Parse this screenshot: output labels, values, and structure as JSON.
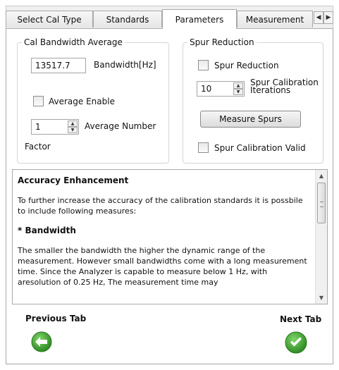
{
  "tabs": [
    {
      "label": "Select Cal Type"
    },
    {
      "label": "Standards"
    },
    {
      "label": "Parameters"
    },
    {
      "label": "Measurement"
    }
  ],
  "cal_bandwidth_average": {
    "group_title": "Cal Bandwidth  Average",
    "bandwidth_value": "13517.7",
    "bandwidth_label": "Bandwidth[Hz]",
    "average_enable_label": "Average Enable",
    "average_enable_checked": false,
    "average_number_value": "1",
    "average_number_label": "Average Number",
    "factor_label": "Factor"
  },
  "spur_reduction": {
    "group_title": "Spur Reduction",
    "spur_reduction_label": "Spur Reduction",
    "spur_reduction_checked": false,
    "iterations_value": "10",
    "iterations_label_line1": "Spur Calibration",
    "iterations_label_line2": "Iterations",
    "measure_spurs_label": "Measure Spurs",
    "calibration_valid_label": "Spur Calibration Valid",
    "calibration_valid_checked": false
  },
  "help": {
    "heading": "Accuracy Enhancement",
    "intro": "To further increase the accuracy of the calibration standards it is possbile to include following measures:",
    "subheading": "* Bandwidth",
    "body": "The smaller the bandwidth the higher the dynamic range of the measurement. However small bandwidths come with a long measurement time. Since the Analyzer is capable to measure below 1 Hz, with aresolution of 0.25 Hz, The measurement time may"
  },
  "navigation": {
    "previous_label": "Previous Tab",
    "next_label": "Next Tab"
  },
  "colors": {
    "nav_green": "#4cb23c",
    "nav_green_dark": "#2e8a22"
  }
}
